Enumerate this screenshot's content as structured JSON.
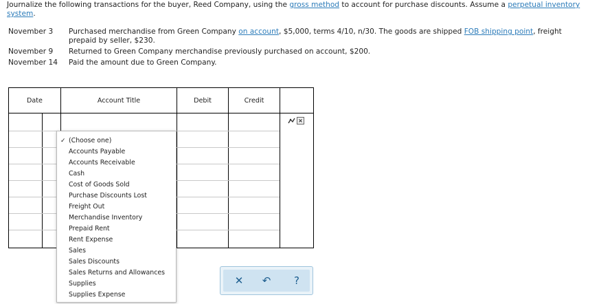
{
  "instructions": {
    "part1": "Journalize the following transactions for the buyer, Reed Company, using the ",
    "link1": "gross method",
    "part2": " to account for purchase discounts. Assume a ",
    "link2": "perpetual inventory system",
    "part3": "."
  },
  "transactions": [
    {
      "date": "November 3",
      "text_a": "Purchased merchandise from Green Company ",
      "link_a": "on account",
      "text_b": ", $5,000, terms 4/10, n/30. The goods are shipped ",
      "link_b": "FOB shipping point",
      "text_c": ", freight prepaid by seller, $230."
    },
    {
      "date": "November 9",
      "text_a": "Returned to Green Company merchandise previously purchased on account, $200."
    },
    {
      "date": "November 14",
      "text_a": "Paid the amount due to Green Company."
    }
  ],
  "journal": {
    "headers": {
      "date": "Date",
      "account_title": "Account Title",
      "debit": "Debit",
      "credit": "Credit"
    }
  },
  "account_dropdown": {
    "selected": "(Choose one)",
    "options": [
      "(Choose one)",
      "Accounts Payable",
      "Accounts Receivable",
      "Cash",
      "Cost of Goods Sold",
      "Purchase Discounts Lost",
      "Freight Out",
      "Merchandise Inventory",
      "Prepaid Rent",
      "Rent Expense",
      "Sales",
      "Sales Discounts",
      "Sales Returns and Allowances",
      "Supplies",
      "Supplies Expense"
    ]
  },
  "toolbar": {
    "close_symbol": "✕",
    "undo_symbol": "↶",
    "help_symbol": "?"
  },
  "colors": {
    "link": "#2b7bb9",
    "toolbar_bg": "#cfe3f1",
    "toolbar_border": "#9fc4dc"
  },
  "icons": [
    "row-options-icon",
    "delete-row-icon",
    "close-icon",
    "undo-icon",
    "help-icon",
    "checkmark-icon"
  ]
}
